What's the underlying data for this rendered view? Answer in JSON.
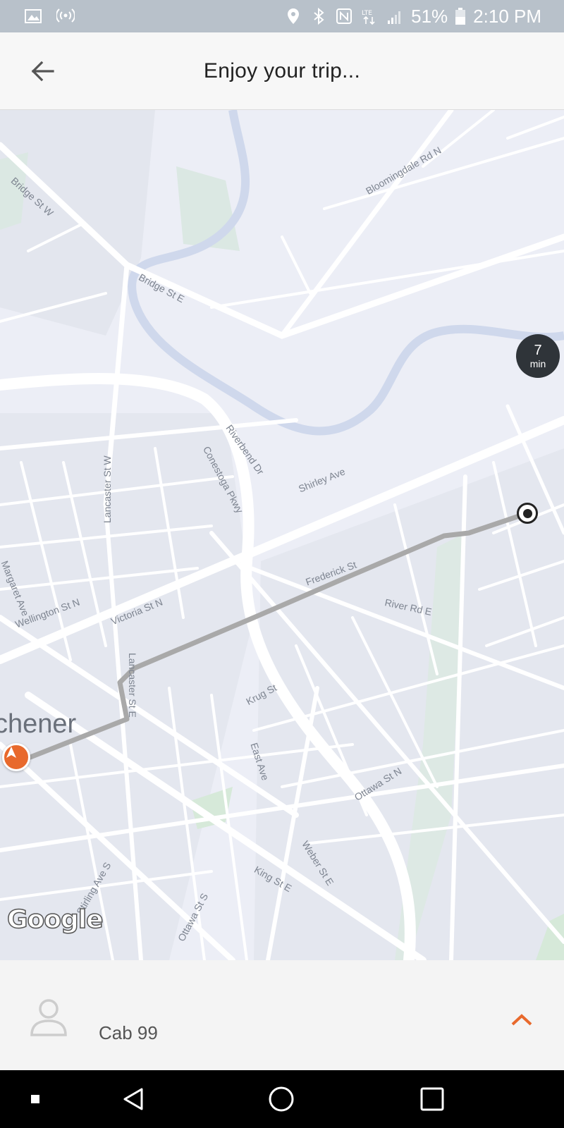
{
  "status_bar": {
    "battery": "51%",
    "time": "2:10 PM",
    "icons": [
      "image-icon",
      "hotspot-icon",
      "location-icon",
      "bluetooth-icon",
      "nfc-icon",
      "lte-icon",
      "signal-icon",
      "battery-icon"
    ]
  },
  "header": {
    "title": "Enjoy your trip...",
    "back_icon": "arrow-left-icon"
  },
  "map": {
    "city_label": "chener",
    "eta": {
      "value": "7",
      "unit": "min"
    },
    "attribution": "Google",
    "route_color": "#a9a9a9",
    "car_color": "#e8692c",
    "road_labels": [
      "Bridge St W",
      "Bloomingdale Rd N",
      "Bridge St E",
      "Riverbend Dr",
      "Conestoga Pkwy",
      "Shirley Ave",
      "Lancaster St W",
      "Margaret Ave",
      "Wellington St N",
      "Victoria St N",
      "Frederick St",
      "River Rd E",
      "Lancaster St E",
      "Krug St",
      "East Ave",
      "Ottawa St N",
      "Weber St E",
      "King St E",
      "Stirling Ave S",
      "Ottawa St S"
    ]
  },
  "bottom_panel": {
    "driver_name": "Cab 99",
    "expand_icon": "chevron-up-icon",
    "accent": "#e8692c"
  },
  "nav_bar": {
    "buttons": [
      "recents-dot",
      "back-triangle",
      "home-circle",
      "overview-square"
    ]
  }
}
